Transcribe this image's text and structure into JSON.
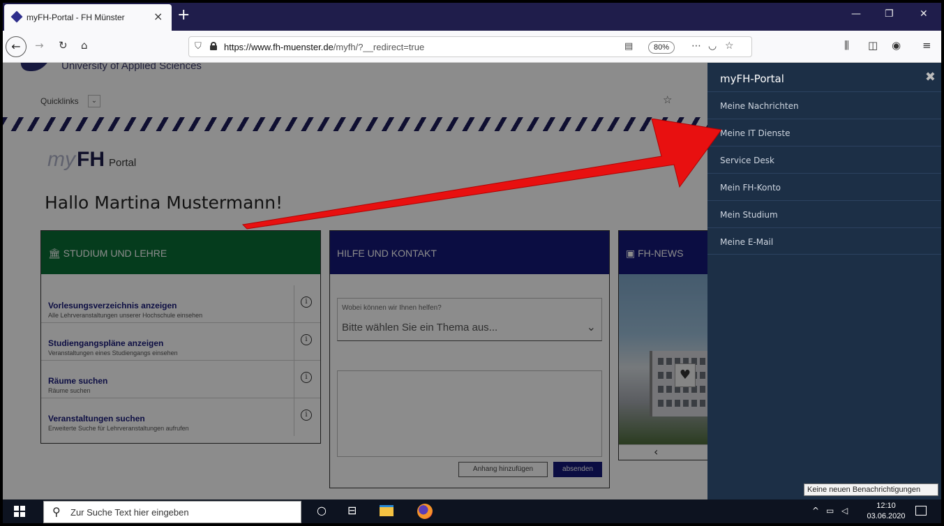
{
  "browser": {
    "tab_title": "myFH-Portal - FH Münster",
    "tab_close": "×",
    "new_tab": "+",
    "url_domain": "https://www.fh-muenster.de",
    "url_path": "/myfh/?__redirect=true",
    "zoom": "80%",
    "minimize": "—",
    "restore": "❐",
    "close": "✕"
  },
  "page": {
    "logo_text": "University of Applied Sciences",
    "quicklinks": "Quicklinks",
    "portal_prefix": "my",
    "portal_fh": "FH",
    "portal_suffix": "Portal",
    "greeting": "Hallo Martina Mustermann!"
  },
  "cards": {
    "studium": {
      "title": "STUDIUM UND LEHRE",
      "items": [
        {
          "title": "Vorlesungsverzeichnis anzeigen",
          "desc": "Alle Lehrveranstaltungen unserer Hochschule einsehen"
        },
        {
          "title": "Studiengangspläne anzeigen",
          "desc": "Veranstaltungen eines Studiengangs einsehen"
        },
        {
          "title": "Räume suchen",
          "desc": "Räume suchen"
        },
        {
          "title": "Veranstaltungen suchen",
          "desc": "Erweiterte Suche für Lehrveranstaltungen aufrufen"
        }
      ]
    },
    "hilfe": {
      "title": "HILFE UND KONTAKT",
      "field_label": "Wobei können wir Ihnen helfen?",
      "select_value": "Bitte wählen Sie ein Thema aus...",
      "attach_button": "Anhang hinzufügen",
      "send_button": "absenden"
    },
    "news": {
      "title": "FH-NEWS"
    }
  },
  "sidebar": {
    "title": "myFH-Portal",
    "close": "✖",
    "items": [
      "Meine Nachrichten",
      "Meine IT Dienste",
      "Service Desk",
      "Mein FH-Konto",
      "Mein Studium",
      "Meine E-Mail"
    ]
  },
  "tooltip": "Keine neuen Benachrichtigungen",
  "taskbar": {
    "search_placeholder": "Zur Suche Text hier eingeben",
    "time": "12:10",
    "date": "03.06.2020"
  },
  "colors": {
    "studium_header": "#0a6d36",
    "hilfe_header": "#141878",
    "sidebar_bg": "#1c2f46",
    "arrow": "#e81010"
  }
}
